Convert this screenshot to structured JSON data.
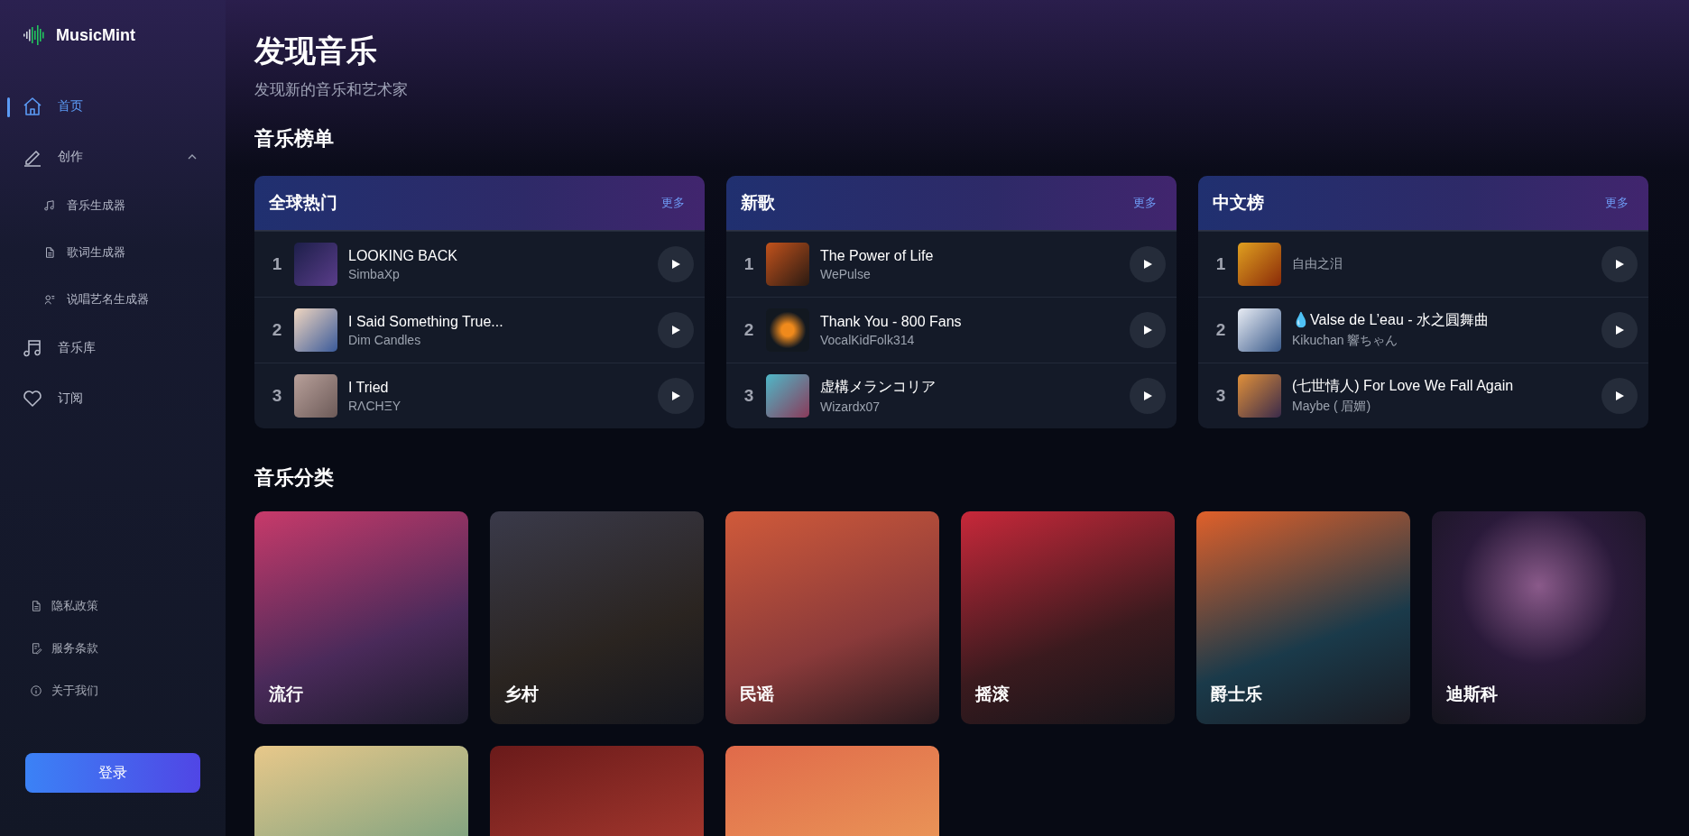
{
  "sidebar": {
    "logo": "MusicMint",
    "nav": [
      {
        "label": "首页",
        "selected": true
      },
      {
        "label": "创作",
        "selected": false,
        "expanded": true,
        "children": [
          {
            "label": "音乐生成器"
          },
          {
            "label": "歌词生成器"
          },
          {
            "label": "说唱艺名生成器"
          }
        ]
      },
      {
        "label": "音乐库",
        "selected": false
      },
      {
        "label": "订阅",
        "selected": false
      }
    ],
    "footer_links": [
      {
        "label": "隐私政策"
      },
      {
        "label": "服务条款"
      },
      {
        "label": "关于我们"
      }
    ],
    "login_button": "登录"
  },
  "header": {
    "title": "发现音乐",
    "subtitle": "发现新的音乐和艺术家"
  },
  "charts_section": {
    "title": "音乐榜单",
    "charts": [
      {
        "title": "全球热门",
        "more": "更多",
        "songs": [
          {
            "rank": "1",
            "title": "LOOKING BACK",
            "artist": "SimbaXp"
          },
          {
            "rank": "2",
            "title": "I Said Something True...",
            "artist": "Dim Candles"
          },
          {
            "rank": "3",
            "title": "I Tried",
            "artist": "RΛCHΞY"
          }
        ]
      },
      {
        "title": "新歌",
        "more": "更多",
        "songs": [
          {
            "rank": "1",
            "title": "The Power of Life",
            "artist": "WePulse"
          },
          {
            "rank": "2",
            "title": "Thank You - 800 Fans",
            "artist": "VocalKidFolk314"
          },
          {
            "rank": "3",
            "title": "虚構メランコリア",
            "artist": "Wizardx07"
          }
        ]
      },
      {
        "title": "中文榜",
        "more": "更多",
        "songs": [
          {
            "rank": "1",
            "artist": "自由之泪"
          },
          {
            "rank": "2",
            "title": "💧Valse de L’eau - 水之圓舞曲",
            "artist": "Kikuchan 響ちゃん"
          },
          {
            "rank": "3",
            "title": "(七世情人) For Love We Fall Again",
            "artist": "Maybe ( 眉媚)"
          }
        ]
      }
    ]
  },
  "categories_section": {
    "title": "音乐分类",
    "categories": [
      {
        "label": "流行"
      },
      {
        "label": "乡村"
      },
      {
        "label": "民谣"
      },
      {
        "label": "摇滚"
      },
      {
        "label": "爵士乐"
      },
      {
        "label": "迪斯科"
      }
    ]
  }
}
